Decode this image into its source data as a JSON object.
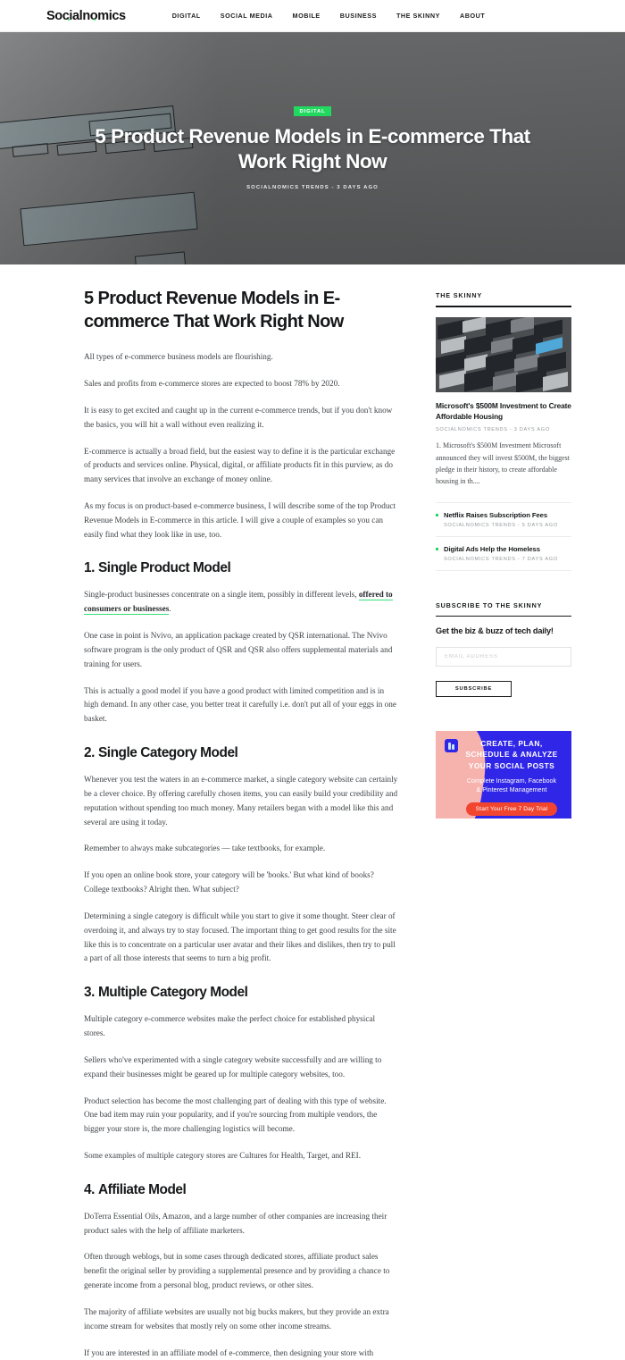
{
  "header": {
    "logo_text": "Socialnomics",
    "nav": [
      {
        "label": "DIGITAL"
      },
      {
        "label": "SOCIAL MEDIA"
      },
      {
        "label": "MOBILE"
      },
      {
        "label": "BUSINESS"
      },
      {
        "label": "THE SKINNY"
      },
      {
        "label": "ABOUT"
      }
    ]
  },
  "hero": {
    "category_badge": "DIGITAL",
    "title": "5 Product Revenue Models in E-commerce That Work Right Now",
    "meta": "SOCIALNOMICS TRENDS  -  3 DAYS AGO",
    "badge_color": "#22d95f"
  },
  "article": {
    "title": "5 Product Revenue Models in E-commerce That Work Right Now",
    "intro": [
      "All types of e-commerce business models are flourishing.",
      "Sales and profits from e-commerce stores are expected to boost 78% by 2020.",
      "It is easy to get excited and caught up in the current e-commerce trends, but if you don't know the basics, you will hit a wall without even realizing it.",
      "E-commerce is actually a broad field, but the easiest way to define it is the particular exchange of products and services online. Physical, digital, or affiliate products fit in this purview, as do many services that involve an exchange of money online.",
      "As my focus is on product-based e-commerce business, I will describe some of the top Product Revenue Models in E-commerce in this article. I will give a couple of examples so you can easily find what they look like in use, too."
    ],
    "sections": [
      {
        "number": "1.",
        "heading": "Single Product Model",
        "para_lead": "Single-product businesses concentrate on a single item, possibly in different levels,",
        "link_text": "offered to consumers or businesses",
        "para_lead_tail": ".",
        "paragraphs": [
          "One case in point is Nvivo, an application package created by QSR international. The Nvivo software program is the only product of QSR and QSR also offers supplemental materials and training for users.",
          "This is actually a good model if you have a good product with limited competition and is in high demand. In any other case, you better treat it carefully i.e. don't put all of your eggs in one basket."
        ]
      },
      {
        "number": "2.",
        "heading": "Single Category Model",
        "paragraphs": [
          "Whenever you test the waters in an e-commerce market, a single category website can certainly be a clever choice. By offering carefully chosen items, you can easily build your credibility and reputation without spending too much money. Many retailers began with a model like this and several are using it today.",
          "Remember to always make subcategories — take textbooks, for example.",
          "If you open an online book store, your category will be 'books.' But what kind of books? College textbooks? Alright then. What subject?",
          "Determining a single category is difficult while you start to give it some thought. Steer clear of overdoing it, and always try to stay focused. The important thing to get good results for the site like this is to concentrate on a particular user avatar and their likes and dislikes, then try to pull a part of all those interests that seems to turn a big profit."
        ]
      },
      {
        "number": "3.",
        "heading": "Multiple Category Model",
        "paragraphs": [
          "Multiple category e-commerce websites make the perfect choice for established physical stores.",
          "Sellers who've experimented with a single category website successfully and are willing to expand their businesses might be geared up for multiple category websites, too.",
          "Product selection has become the most challenging part of dealing with this type of website. One bad item may ruin your popularity, and if you're sourcing from multiple vendors, the bigger your store is, the more challenging logistics will become.",
          "Some examples of multiple category stores are Cultures for Health, Target, and REI."
        ]
      },
      {
        "number": "4.",
        "heading": "Affiliate Model",
        "paragraphs": [
          "DoTerra Essential Oils, Amazon, and a large number of other companies are increasing their product sales with the help of affiliate marketers.",
          "Often through weblogs, but in some cases through dedicated stores, affiliate product sales benefit the original seller by providing a supplemental presence and by providing a chance to generate income from a personal blog, product reviews, or other sites.",
          "The majority of affiliate websites are usually not big bucks makers, but they provide an extra income stream for websites that mostly rely on some other income streams.",
          "If you are interested in an affiliate model of e-commerce, then designing your store with"
        ]
      }
    ]
  },
  "sidebar": {
    "skinny": {
      "title": "THE SKINNY",
      "featured": {
        "headline": "Microsoft's $500M Investment to Create Affordable Housing",
        "meta": "SOCIALNOMICS TRENDS  -  3 DAYS AGO",
        "excerpt": "1. Microsoft's $500M Investment Microsoft announced they will invest $500M, the biggest pledge in their history, to create affordable housing in th...."
      },
      "items": [
        {
          "title": "Netflix Raises Subscription Fees",
          "meta": "SOCIALNOMICS TRENDS  -  5 DAYS AGO"
        },
        {
          "title": "Digital Ads Help the Homeless",
          "meta": "SOCIALNOMICS TRENDS  -  7 DAYS AGO"
        }
      ],
      "bullet_color": "#22d95f"
    },
    "subscribe": {
      "title": "SUBSCRIBE TO THE SKINNY",
      "tagline": "Get the biz & buzz of tech daily!",
      "email_placeholder": "EMAIL ADDRESS",
      "email_value": "",
      "button_label": "SUBSCRIBE"
    },
    "ad": {
      "headline_line1": "CREATE, PLAN,",
      "headline_line2": "SCHEDULE & ANALYZE",
      "headline_line3": "YOUR SOCIAL POSTS",
      "subline1": "Complete Instagram, Facebook",
      "subline2": "& Pinterest Management",
      "cta": "Start Your Free 7 Day Trial",
      "bg_color": "#3026e8",
      "cta_color": "#f2452f"
    }
  }
}
